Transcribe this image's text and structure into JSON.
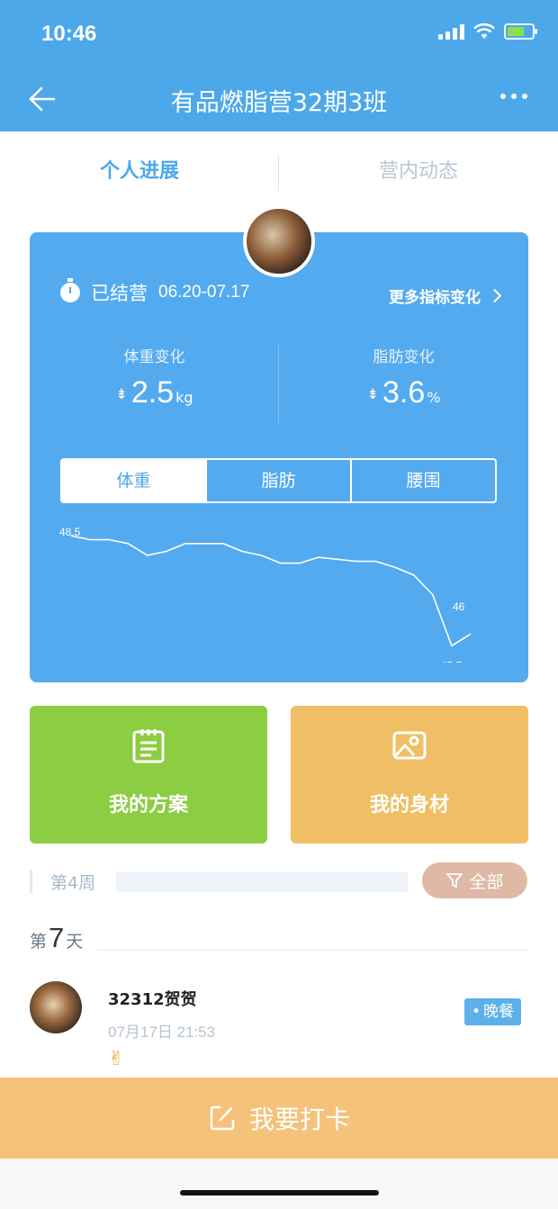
{
  "status_bar": {
    "time": "10:46"
  },
  "header": {
    "title": "有品燃脂营32期3班"
  },
  "tabs": [
    {
      "label": "个人进展",
      "active": true
    },
    {
      "label": "营内动态",
      "active": false
    }
  ],
  "card": {
    "status_label": "已结营",
    "date_range": "06.20-07.17",
    "more_metrics_label": "更多指标变化",
    "weight_change": {
      "label": "体重变化",
      "value": "2.5",
      "unit": "kg"
    },
    "fat_change": {
      "label": "脂肪变化",
      "value": "3.6",
      "unit": "%"
    },
    "segments": [
      "体重",
      "脂肪",
      "腰围"
    ],
    "active_segment": "体重"
  },
  "chart_data": {
    "type": "line",
    "series": [
      {
        "values": [
          48.5,
          48.4,
          48.4,
          48.3,
          48.0,
          48.1,
          48.3,
          48.3,
          48.3,
          48.1,
          48.0,
          47.8,
          47.8,
          47.95,
          47.9,
          47.85,
          47.85,
          47.7,
          47.5,
          47.0,
          45.7,
          46.0
        ]
      }
    ],
    "labels": {
      "start": "48.5",
      "high": "46",
      "low": "45.7"
    },
    "ylim": [
      45.5,
      48.8
    ],
    "grid": false
  },
  "tiles": {
    "plan_label": "我的方案",
    "body_label": "我的身材"
  },
  "week": {
    "label": "第4周",
    "filter_label": "全部"
  },
  "day": {
    "prefix": "第",
    "number": "7",
    "suffix": "天"
  },
  "post": {
    "author": "32312贺贺",
    "time": "07月17日  21:53",
    "content": "✌",
    "meal_tag": "晚餐"
  },
  "checkin": {
    "label": "我要打卡"
  },
  "colors": {
    "primary": "#4da8ea",
    "card": "#53aaef",
    "plan_tile": "#8ccd42",
    "body_tile": "#f0be64",
    "checkin": "#f4c27a",
    "filter": "#dfb9a6"
  }
}
